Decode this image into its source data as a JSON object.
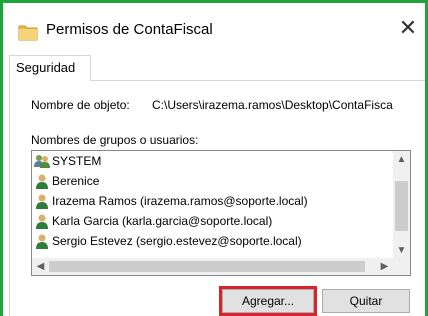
{
  "window": {
    "title": "Permisos de ContaFiscal",
    "close_label": "✕",
    "icons": {
      "window": "folder-icon",
      "close": "close-icon"
    },
    "frame_color": "#1fa33b"
  },
  "tabs": [
    {
      "label": "Seguridad",
      "active": true
    }
  ],
  "object": {
    "label": "Nombre de objeto:",
    "path": "C:\\Users\\irazema.ramos\\Desktop\\ContaFisca"
  },
  "groups": {
    "label": "Nombres de grupos o usuarios:",
    "items": [
      {
        "label": "SYSTEM",
        "icon": "group-icon"
      },
      {
        "label": "Berenice",
        "icon": "user-icon"
      },
      {
        "label": "Irazema Ramos (irazema.ramos@soporte.local)",
        "icon": "user-icon"
      },
      {
        "label": "Karla Garcia (karla.garcia@soporte.local)",
        "icon": "user-icon"
      },
      {
        "label": "Sergio Estevez (sergio.estevez@soporte.local)",
        "icon": "user-icon"
      }
    ],
    "scroll_icons": {
      "up": "chevron-up-icon",
      "down": "chevron-down-icon",
      "left": "chevron-left-icon",
      "right": "chevron-right-icon"
    }
  },
  "buttons": {
    "add_label": "Agregar...",
    "remove_label": "Quitar",
    "highlight_color": "#d9232e"
  }
}
